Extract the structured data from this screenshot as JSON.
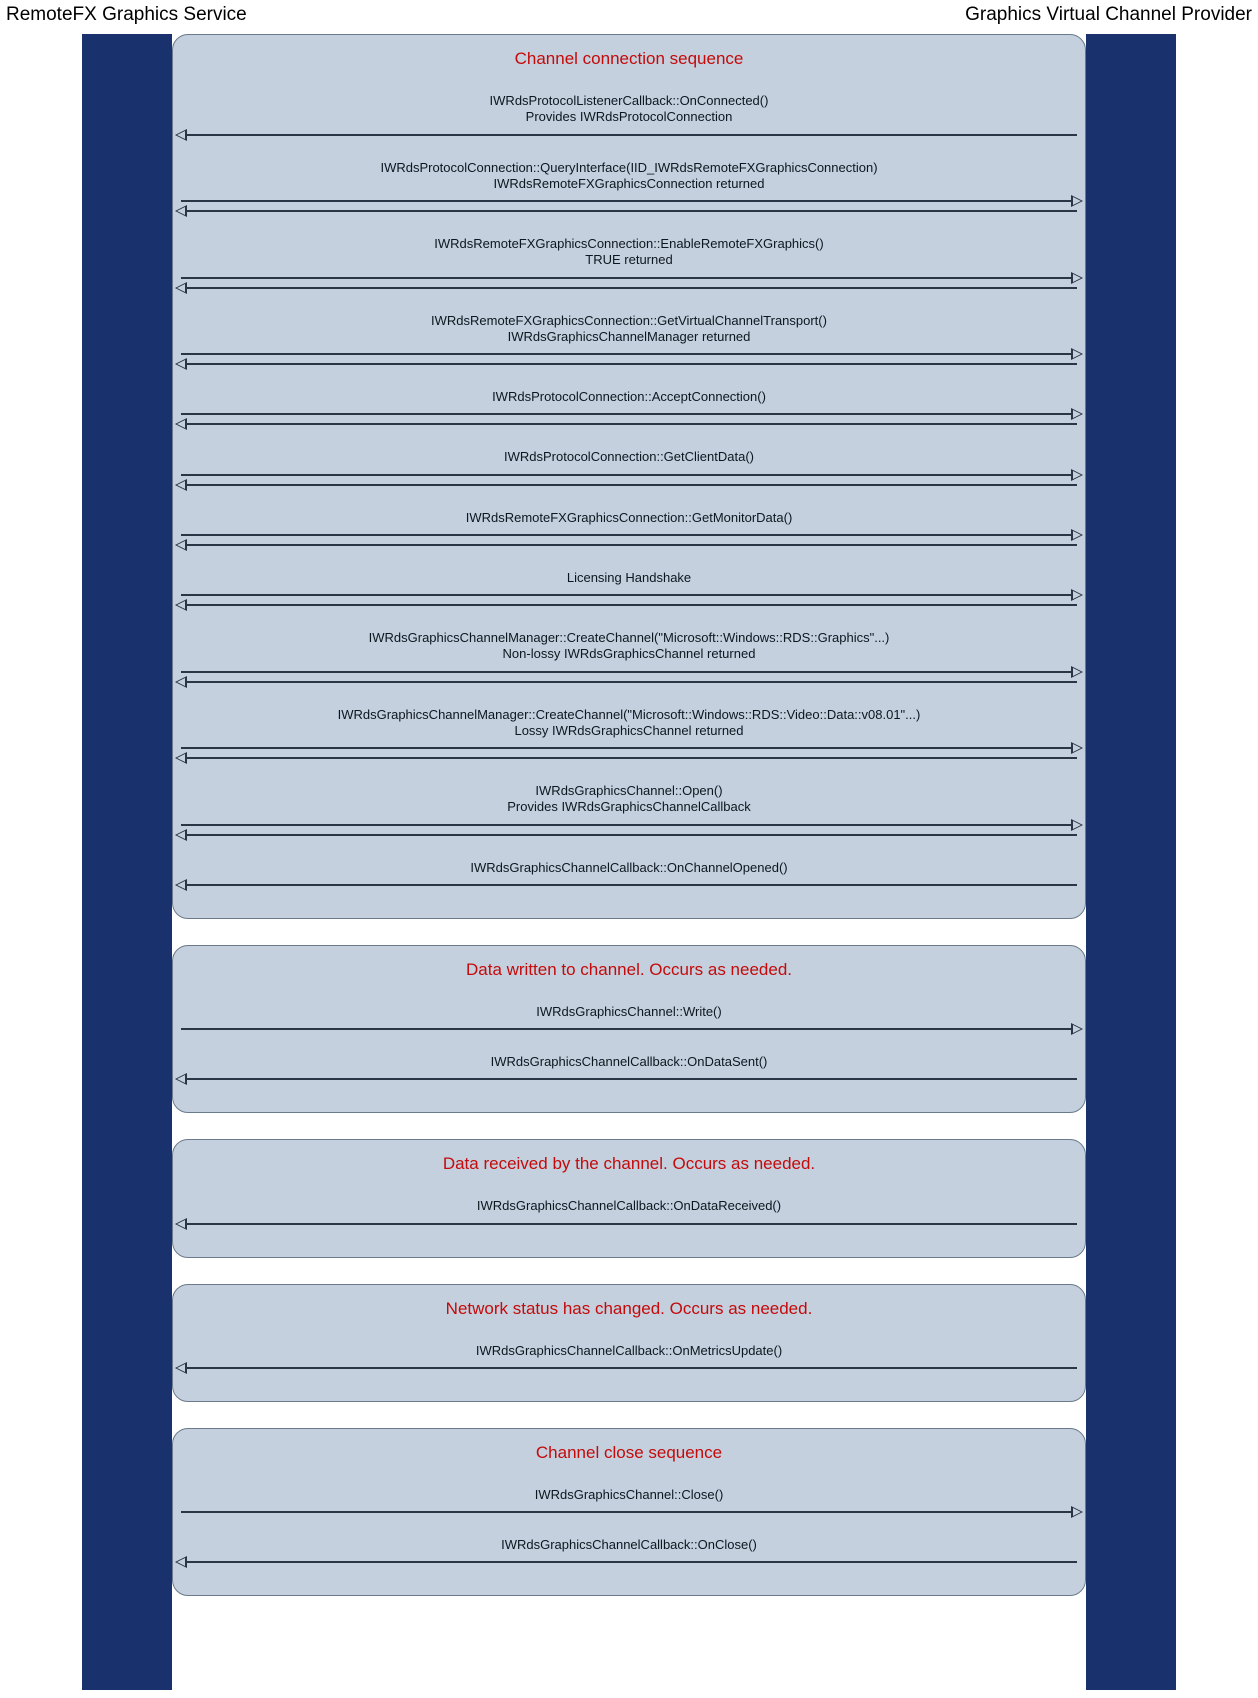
{
  "actors": {
    "left": "RemoteFX Graphics Service",
    "right": "Graphics Virtual Channel Provider"
  },
  "groups": [
    {
      "title": "Channel connection sequence",
      "messages": [
        {
          "text": "IWRdsProtocolListenerCallback::OnConnected()\nProvides IWRdsProtocolConnection",
          "dir": "r2l"
        },
        {
          "text": "IWRdsProtocolConnection::QueryInterface(IID_IWRdsRemoteFXGraphicsConnection)\nIWRdsRemoteFXGraphicsConnection returned",
          "dir": "both"
        },
        {
          "text": "IWRdsRemoteFXGraphicsConnection::EnableRemoteFXGraphics()\nTRUE returned",
          "dir": "both"
        },
        {
          "text": "IWRdsRemoteFXGraphicsConnection::GetVirtualChannelTransport()\nIWRdsGraphicsChannelManager returned",
          "dir": "both"
        },
        {
          "text": "IWRdsProtocolConnection::AcceptConnection()",
          "dir": "both"
        },
        {
          "text": "IWRdsProtocolConnection::GetClientData()",
          "dir": "both"
        },
        {
          "text": "IWRdsRemoteFXGraphicsConnection::GetMonitorData()",
          "dir": "both"
        },
        {
          "text": "Licensing Handshake",
          "dir": "both"
        },
        {
          "text": "IWRdsGraphicsChannelManager::CreateChannel(\"Microsoft::Windows::RDS::Graphics\"...)\nNon-lossy IWRdsGraphicsChannel returned",
          "dir": "both"
        },
        {
          "text": "IWRdsGraphicsChannelManager::CreateChannel(\"Microsoft::Windows::RDS::Video::Data::v08.01\"...)\nLossy IWRdsGraphicsChannel returned",
          "dir": "both"
        },
        {
          "text": "IWRdsGraphicsChannel::Open()\nProvides IWRdsGraphicsChannelCallback",
          "dir": "both"
        },
        {
          "text": "IWRdsGraphicsChannelCallback::OnChannelOpened()",
          "dir": "r2l"
        }
      ]
    },
    {
      "title": "Data written to channel. Occurs as needed.",
      "messages": [
        {
          "text": "IWRdsGraphicsChannel::Write()",
          "dir": "l2r"
        },
        {
          "text": "IWRdsGraphicsChannelCallback::OnDataSent()",
          "dir": "r2l"
        }
      ]
    },
    {
      "title": "Data received by the channel. Occurs as needed.",
      "messages": [
        {
          "text": "IWRdsGraphicsChannelCallback::OnDataReceived()",
          "dir": "r2l"
        }
      ]
    },
    {
      "title": "Network status has changed. Occurs as needed.",
      "messages": [
        {
          "text": "IWRdsGraphicsChannelCallback::OnMetricsUpdate()",
          "dir": "r2l"
        }
      ]
    },
    {
      "title": "Channel close sequence",
      "messages": [
        {
          "text": "IWRdsGraphicsChannel::Close()",
          "dir": "l2r"
        },
        {
          "text": "IWRdsGraphicsChannelCallback::OnClose()",
          "dir": "r2l"
        }
      ]
    }
  ]
}
